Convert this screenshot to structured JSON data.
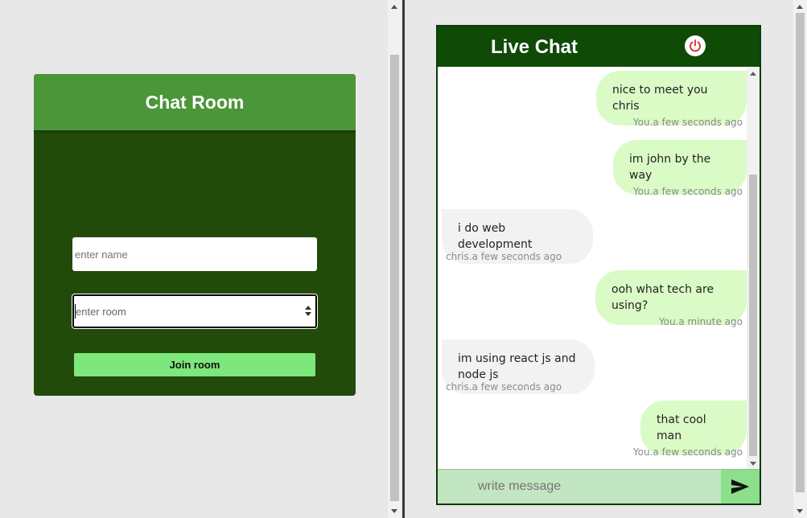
{
  "join": {
    "title": "Chat Room",
    "name_placeholder": "enter name",
    "room_placeholder": "enter room",
    "join_label": "Join room"
  },
  "chat": {
    "title": "Live Chat",
    "power_icon": "power-icon",
    "messages": [
      {
        "author": "me",
        "text": "nice to meet you chris",
        "meta": "You.a few seconds ago"
      },
      {
        "author": "me",
        "text": "im john by the way",
        "meta": "You.a few seconds ago"
      },
      {
        "author": "them",
        "text": "i do web development",
        "meta": "chris.a few seconds ago"
      },
      {
        "author": "me",
        "text": "ooh what tech are using?",
        "meta": "You.a minute ago"
      },
      {
        "author": "them",
        "text": "im using react js and node js",
        "meta": "chris.a few seconds ago"
      },
      {
        "author": "me",
        "text": "that cool man",
        "meta": "You.a few seconds ago"
      }
    ],
    "composer_placeholder": "write message",
    "send_icon": "send-icon"
  },
  "colors": {
    "join_header": "#4a9639",
    "join_body": "#214a0b",
    "join_button": "#7ce77b",
    "chat_header": "#0f4a07",
    "my_bubble": "#dafbc5",
    "their_bubble": "#f2f2f2",
    "composer_bg": "#c2e6c1",
    "send_bg": "#8ce08b"
  }
}
